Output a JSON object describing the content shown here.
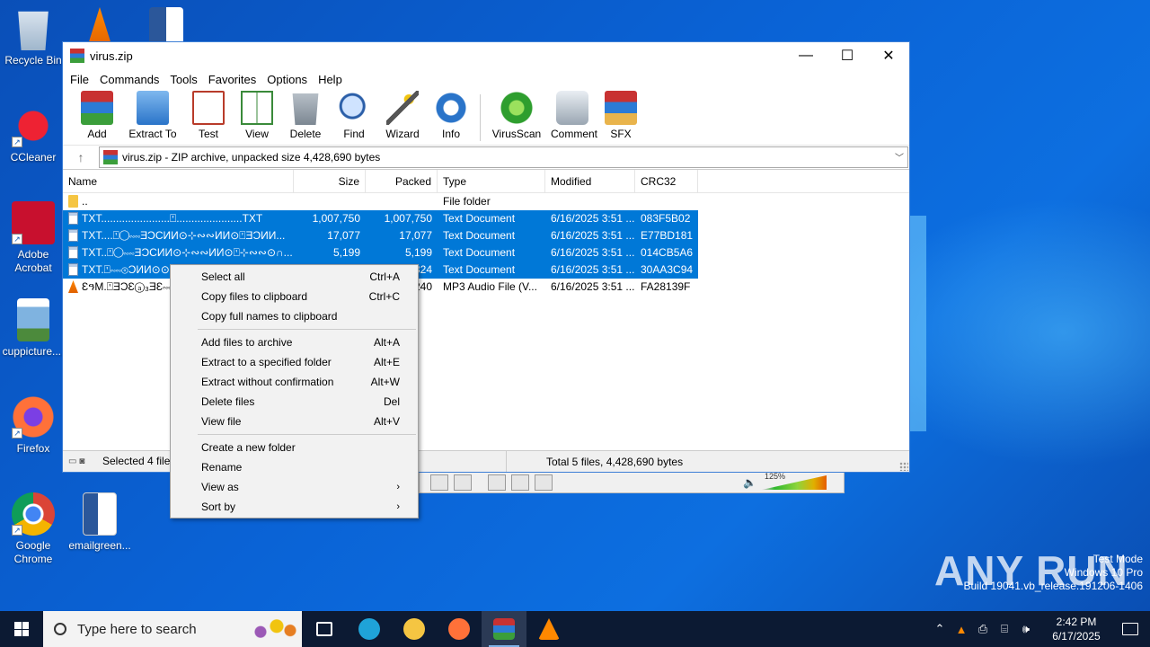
{
  "desktop": {
    "icons": [
      {
        "label": "Recycle Bin",
        "icon": "recycle-bin-icon"
      },
      {
        "label": "CCleaner",
        "icon": "ccleaner-icon"
      },
      {
        "label": "Adobe Acrobat",
        "icon": "acrobat-icon"
      },
      {
        "label": "cuppicture....",
        "icon": "image-file-icon"
      },
      {
        "label": "Firefox",
        "icon": "firefox-icon"
      },
      {
        "label": "Google Chrome",
        "icon": "chrome-icon"
      },
      {
        "label": "emailgreen...",
        "icon": "word-document-icon"
      }
    ],
    "watermark": {
      "line1": "Test Mode",
      "line2": "Windows 10 Pro",
      "line3": "Build 19041.vb_release.191206-1406"
    },
    "brand": "ANY RUN"
  },
  "vlc": {
    "volume_label": "125%",
    "volume_level": 1.25
  },
  "window": {
    "title": "virus.zip",
    "controls": {
      "minimize": "—",
      "maximize": "☐",
      "close": "✕"
    },
    "menu": [
      "File",
      "Commands",
      "Tools",
      "Favorites",
      "Options",
      "Help"
    ],
    "toolbar": [
      {
        "label": "Add",
        "icon": "add-archive-icon"
      },
      {
        "label": "Extract To",
        "icon": "extract-folder-icon"
      },
      {
        "label": "Test",
        "icon": "test-clipboard-icon"
      },
      {
        "label": "View",
        "icon": "view-book-icon"
      },
      {
        "label": "Delete",
        "icon": "trash-icon"
      },
      {
        "label": "Find",
        "icon": "magnifier-icon"
      },
      {
        "label": "Wizard",
        "icon": "wand-icon"
      },
      {
        "label": "Info",
        "icon": "info-icon"
      },
      {
        "label": "VirusScan",
        "icon": "virus-scan-icon"
      },
      {
        "label": "Comment",
        "icon": "comment-icon"
      },
      {
        "label": "SFX",
        "icon": "sfx-box-icon"
      }
    ],
    "address": "virus.zip - ZIP archive, unpacked size 4,428,690 bytes",
    "columns": {
      "name": "Name",
      "size": "Size",
      "packed": "Packed",
      "type": "Type",
      "modified": "Modified",
      "crc": "CRC32"
    },
    "files": [
      {
        "name": "..",
        "size": "",
        "packed": "",
        "type": "File folder",
        "modified": "",
        "crc": "",
        "icon": "folder",
        "selected": false
      },
      {
        "name": "TXT.......................⍞......................TXT",
        "size": "1,007,750",
        "packed": "1,007,750",
        "type": "Text Document",
        "modified": "6/16/2025 3:51 ...",
        "crc": "083F5B02",
        "icon": "txt",
        "selected": true
      },
      {
        "name": "TXT....⍞◯∾∾ƎƆCИИ⊙⊹∾∾ИИ⊙⍞ƎƆИИ...",
        "size": "17,077",
        "packed": "17,077",
        "type": "Text Document",
        "modified": "6/16/2025 3:51 ...",
        "crc": "E77BD181",
        "icon": "txt",
        "selected": true
      },
      {
        "name": "TXT..⍞◯∾∾ƎƆCИИ⊙⊹∾∾ИИ⊙⍞⊹∾∾⊙∩...",
        "size": "5,199",
        "packed": "5,199",
        "type": "Text Document",
        "modified": "6/16/2025 3:51 ...",
        "crc": "014CB5A6",
        "icon": "txt",
        "selected": true
      },
      {
        "name": "TXT.⍞∾∾⊚ƆИИ⊙⊙...",
        "size": "",
        "packed": "324",
        "type": "Text Document",
        "modified": "6/16/2025 3:51 ...",
        "crc": "30AA3C94",
        "icon": "txt",
        "selected": true
      },
      {
        "name": "ƐዓM.⍞ƎƆƐⓐ₃ƎƐ∾∾...",
        "size": "",
        "packed": "240",
        "type": "MP3 Audio File (V...",
        "modified": "6/16/2025 3:51 ...",
        "crc": "FA28139F",
        "icon": "mp3",
        "selected": false
      }
    ],
    "status_left": "Selected 4 files",
    "status_right": "Total 5 files, 4,428,690 bytes"
  },
  "context_menu": {
    "groups": [
      [
        {
          "label": "Select all",
          "shortcut": "Ctrl+A"
        },
        {
          "label": "Copy files to clipboard",
          "shortcut": "Ctrl+C"
        },
        {
          "label": "Copy full names to clipboard",
          "shortcut": ""
        }
      ],
      [
        {
          "label": "Add files to archive",
          "shortcut": "Alt+A"
        },
        {
          "label": "Extract to a specified folder",
          "shortcut": "Alt+E"
        },
        {
          "label": "Extract without confirmation",
          "shortcut": "Alt+W"
        },
        {
          "label": "Delete files",
          "shortcut": "Del"
        },
        {
          "label": "View file",
          "shortcut": "Alt+V"
        }
      ],
      [
        {
          "label": "Create a new folder",
          "shortcut": ""
        },
        {
          "label": "Rename",
          "shortcut": ""
        },
        {
          "label": "View as",
          "shortcut": "›"
        },
        {
          "label": "Sort by",
          "shortcut": "›"
        }
      ]
    ]
  },
  "taskbar": {
    "search_placeholder": "Type here to search",
    "apps": [
      {
        "name": "task-view-icon",
        "active": false,
        "color": "#ffffff"
      },
      {
        "name": "edge-icon",
        "active": false,
        "color": "#1fa3d8"
      },
      {
        "name": "file-explorer-icon",
        "active": false,
        "color": "#f5c542"
      },
      {
        "name": "firefox-icon",
        "active": false,
        "color": "#ff7139"
      },
      {
        "name": "winrar-icon",
        "active": true,
        "color": "#c83232"
      },
      {
        "name": "vlc-icon",
        "active": false,
        "color": "#ff8800"
      }
    ],
    "time": "2:42 PM",
    "date": "6/17/2025"
  }
}
